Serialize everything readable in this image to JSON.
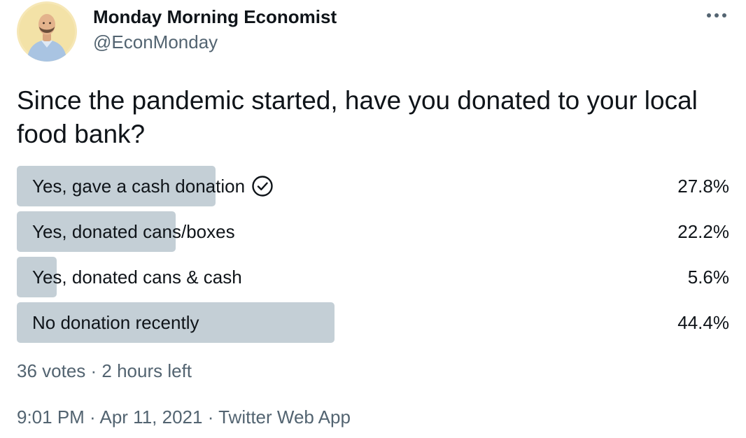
{
  "author": {
    "display_name": "Monday Morning Economist",
    "handle": "@EconMonday",
    "avatar_icon": "person-avatar-icon"
  },
  "menu": {
    "icon": "more-horizontal-icon"
  },
  "tweet": {
    "text": "Since the pandemic started, have you donated to your local food bank?"
  },
  "poll": {
    "fill_color": "#c4cfd6",
    "choices": [
      {
        "label": "Yes, gave a cash donation",
        "percent": "27.8%",
        "fraction": 0.278,
        "selected": true
      },
      {
        "label": "Yes, donated cans/boxes",
        "percent": "22.2%",
        "fraction": 0.222,
        "selected": false
      },
      {
        "label": "Yes, donated cans & cash",
        "percent": "5.6%",
        "fraction": 0.056,
        "selected": false
      },
      {
        "label": "No donation recently",
        "percent": "44.4%",
        "fraction": 0.444,
        "selected": false
      }
    ],
    "votes": "36 votes",
    "separator": " · ",
    "time_left": "2 hours left"
  },
  "footer": {
    "time": "9:01 PM",
    "date": "Apr 11, 2021",
    "source": "Twitter Web App",
    "separator": " · "
  }
}
